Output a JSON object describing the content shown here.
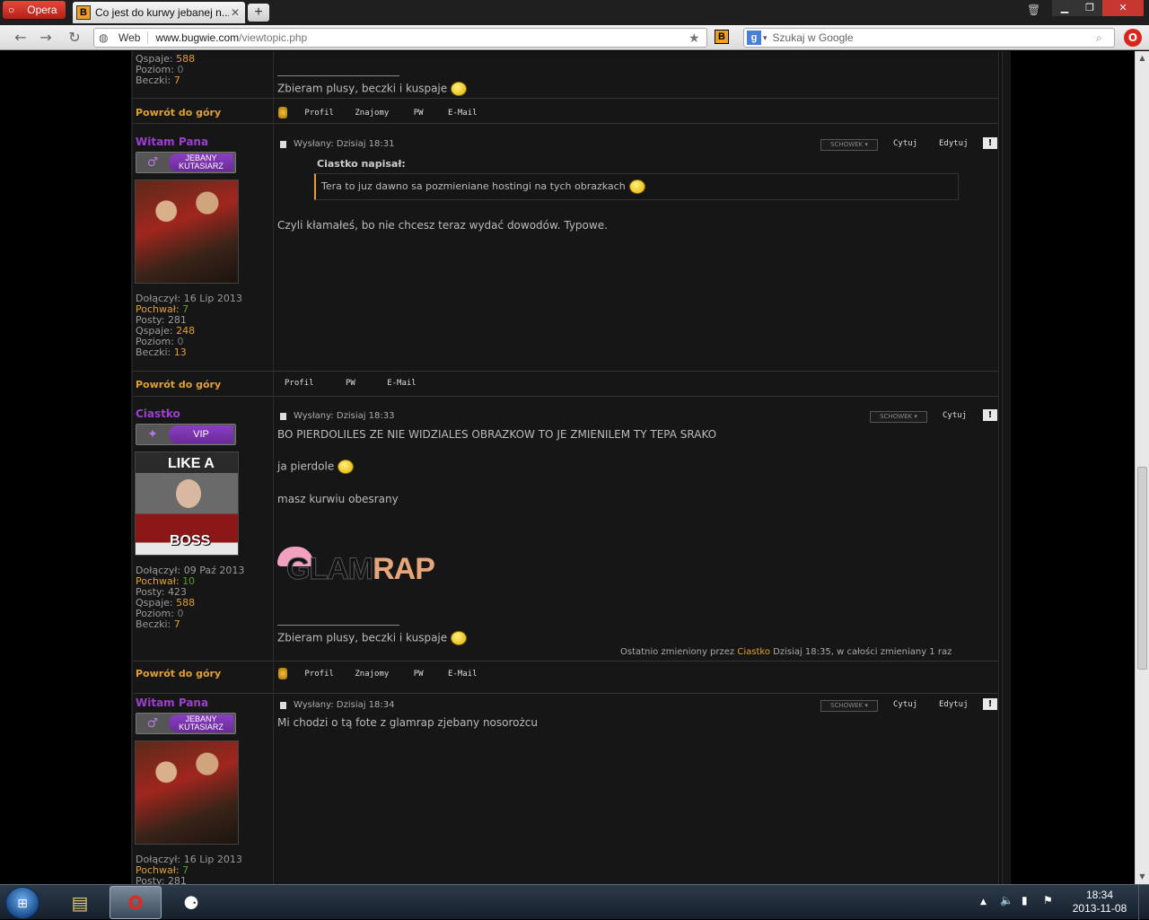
{
  "browser": {
    "menu_label": "Opera",
    "tab_title": "Co jest do kurwy jebanej n...",
    "tab_favicon": "B",
    "new_tab": "+",
    "address_mode": "Web",
    "url_host": "www.bugwie.com",
    "url_path": "/viewtopic.php",
    "extension_label": "B",
    "search_engine": "g",
    "search_placeholder": "Szukaj w Google"
  },
  "posts": [
    {
      "partial_stats": {
        "qspaje_label": "Qspaje:",
        "qspaje": "588",
        "poziom_label": "Poziom:",
        "poziom": "0",
        "beczki_label": "Beczki:",
        "beczki": "7"
      },
      "signature": "Zbieram plusy, beczki i kuspaje",
      "back_to_top": "Powrót do góry",
      "footer_links": [
        "Profil",
        "Znajomy",
        "PW",
        "E-Mail"
      ]
    },
    {
      "username": "Witam Pana",
      "rank": "JEBANY KUTASIARZ",
      "posted": "Wysłany: Dzisiaj 18:31",
      "schowek": "SCHOWEK ▾",
      "quote_btn": "Cytuj",
      "edit_btn": "Edytuj",
      "report_btn": "!",
      "quote_author": "Ciastko napisał:",
      "quote_text": "Tera to juz dawno sa pozmieniane hostingi na tych obrazkach",
      "body": "Czyli kłamałeś, bo nie chcesz teraz wydać dowodów. Typowe.",
      "stats": {
        "joined_label": "Dołączył:",
        "joined": "16 Lip 2013",
        "praised_label": "Pochwał:",
        "praised": "7",
        "posts_label": "Posty:",
        "posts": "281",
        "qspaje_label": "Qspaje:",
        "qspaje": "248",
        "poziom_label": "Poziom:",
        "poziom": "0",
        "beczki_label": "Beczki:",
        "beczki": "13"
      },
      "back_to_top": "Powrót do góry",
      "footer_links": [
        "Profil",
        "PW",
        "E-Mail"
      ]
    },
    {
      "username": "Ciastko",
      "rank": "VIP",
      "avatar_top": "LIKE A",
      "avatar_bottom": "BOSS",
      "posted": "Wysłany: Dzisiaj 18:33",
      "schowek": "SCHOWEK ▾",
      "quote_btn": "Cytuj",
      "report_btn": "!",
      "body_lines": [
        "BO PIERDOLILES ZE NIE WIDZIALES OBRAZKOW TO JE ZMIENILEM TY TEPA SRAKO",
        "ja pierdole",
        "masz kurwiu obesrany"
      ],
      "image_text_a": "GLAM",
      "image_text_b": "RAP",
      "signature": "Zbieram plusy, beczki i kuspaje",
      "edited_prefix": "Ostatnio zmieniony przez",
      "edited_user": "Ciastko",
      "edited_suffix": "Dzisiaj 18:35, w całości zmieniany 1 raz",
      "stats": {
        "joined_label": "Dołączył:",
        "joined": "09 Paź 2013",
        "praised_label": "Pochwał:",
        "praised": "10",
        "posts_label": "Posty:",
        "posts": "423",
        "qspaje_label": "Qspaje:",
        "qspaje": "588",
        "poziom_label": "Poziom:",
        "poziom": "0",
        "beczki_label": "Beczki:",
        "beczki": "7"
      },
      "back_to_top": "Powrót do góry",
      "footer_links": [
        "Profil",
        "Znajomy",
        "PW",
        "E-Mail"
      ]
    },
    {
      "username": "Witam Pana",
      "rank": "JEBANY KUTASIARZ",
      "posted": "Wysłany: Dzisiaj 18:34",
      "schowek": "SCHOWEK ▾",
      "quote_btn": "Cytuj",
      "edit_btn": "Edytuj",
      "report_btn": "!",
      "body": "Mi chodzi o tą fote z glamrap zjebany nosorożcu",
      "stats": {
        "joined_label": "Dołączył:",
        "joined": "16 Lip 2013",
        "praised_label": "Pochwał:",
        "praised": "7",
        "posts_label": "Posty:",
        "posts": "281"
      }
    }
  ],
  "taskbar": {
    "opera_label": "O",
    "time": "18:34",
    "date": "2013-11-08"
  },
  "colors": {
    "accent_orange": "#e0a030",
    "username_purple": "#9c3fd0",
    "bg": "#161616"
  }
}
